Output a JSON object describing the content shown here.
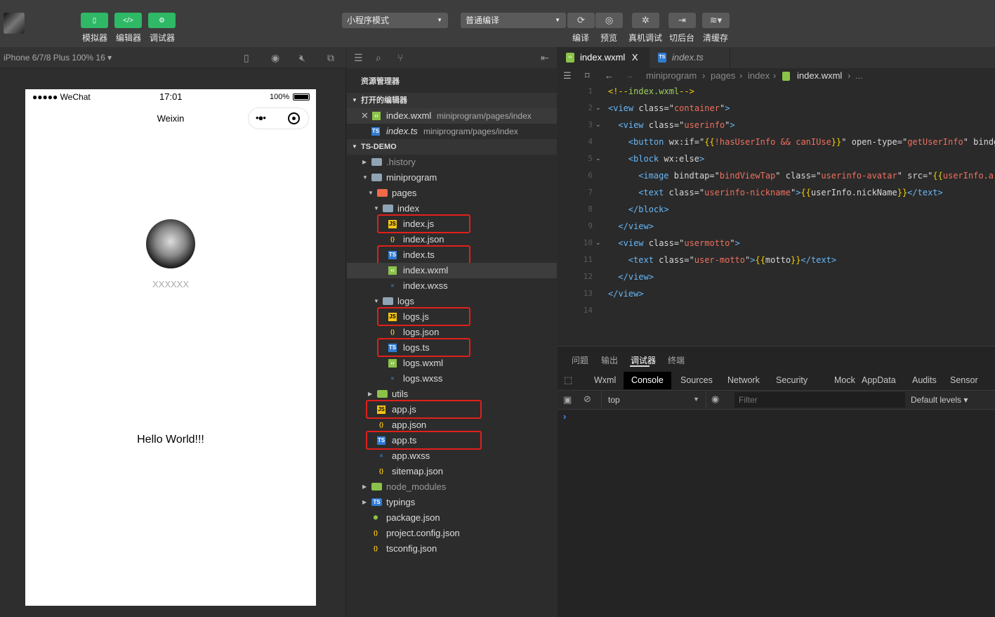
{
  "toolbar": {
    "view_buttons": [
      {
        "label": "模拟器",
        "icon": "phone-icon"
      },
      {
        "label": "编辑器",
        "icon": "code-icon"
      },
      {
        "label": "调试器",
        "icon": "debug-icon"
      }
    ],
    "mode_select": "小程序模式",
    "compile_select": "普通编译",
    "actions": [
      {
        "label": "编译",
        "icon": "refresh-icon"
      },
      {
        "label": "预览",
        "icon": "eye-icon"
      },
      {
        "label": "真机调试",
        "icon": "bug-icon"
      },
      {
        "label": "切后台",
        "icon": "switch-icon"
      },
      {
        "label": "清缓存",
        "icon": "layers-icon"
      }
    ]
  },
  "simulator": {
    "device": "iPhone 6/7/8 Plus 100% 16 ▾",
    "status_carrier": "●●●●● WeChat",
    "status_time": "17:01",
    "status_battery": "100%",
    "nav_title": "Weixin",
    "nickname": "XXXXXX",
    "motto": "Hello World!!!"
  },
  "explorer": {
    "title": "资源管理器",
    "open_editors_label": "打开的编辑器",
    "open_editors": [
      {
        "name": "index.wxml",
        "path": "miniprogram/pages/index",
        "type": "wxml"
      },
      {
        "name": "index.ts",
        "path": "miniprogram/pages/index",
        "type": "ts"
      }
    ],
    "project_label": "TS-DEMO",
    "tree": [
      {
        "name": ".history",
        "level": 1,
        "kind": "folder",
        "open": false,
        "dim": true
      },
      {
        "name": "miniprogram",
        "level": 1,
        "kind": "folder",
        "open": true
      },
      {
        "name": "pages",
        "level": 2,
        "kind": "folder-pages",
        "open": true
      },
      {
        "name": "index",
        "level": 3,
        "kind": "folder",
        "open": true
      },
      {
        "name": "index.js",
        "level": 4,
        "kind": "js",
        "highlight": true
      },
      {
        "name": "index.json",
        "level": 4,
        "kind": "json"
      },
      {
        "name": "index.ts",
        "level": 4,
        "kind": "ts",
        "highlight": true
      },
      {
        "name": "index.wxml",
        "level": 4,
        "kind": "wxml",
        "selected": true
      },
      {
        "name": "index.wxss",
        "level": 4,
        "kind": "wxss"
      },
      {
        "name": "logs",
        "level": 3,
        "kind": "folder",
        "open": true
      },
      {
        "name": "logs.js",
        "level": 4,
        "kind": "js",
        "highlight": true
      },
      {
        "name": "logs.json",
        "level": 4,
        "kind": "json"
      },
      {
        "name": "logs.ts",
        "level": 4,
        "kind": "ts",
        "highlight": true
      },
      {
        "name": "logs.wxml",
        "level": 4,
        "kind": "wxml"
      },
      {
        "name": "logs.wxss",
        "level": 4,
        "kind": "wxss"
      },
      {
        "name": "utils",
        "level": 2,
        "kind": "folder-green",
        "open": false
      },
      {
        "name": "app.js",
        "level": 2,
        "kind": "js",
        "highlight": true,
        "file": true
      },
      {
        "name": "app.json",
        "level": 2,
        "kind": "json",
        "file": true
      },
      {
        "name": "app.ts",
        "level": 2,
        "kind": "ts",
        "highlight": true,
        "file": true
      },
      {
        "name": "app.wxss",
        "level": 2,
        "kind": "wxss",
        "file": true
      },
      {
        "name": "sitemap.json",
        "level": 2,
        "kind": "json",
        "file": true
      },
      {
        "name": "node_modules",
        "level": 1,
        "kind": "folder-green",
        "open": false,
        "dim": true
      },
      {
        "name": "typings",
        "level": 1,
        "kind": "folder-blue",
        "open": false
      },
      {
        "name": "package.json",
        "level": 1,
        "kind": "pkg",
        "file": true
      },
      {
        "name": "project.config.json",
        "level": 1,
        "kind": "json",
        "file": true
      },
      {
        "name": "tsconfig.json",
        "level": 1,
        "kind": "json",
        "file": true
      }
    ]
  },
  "editor": {
    "tabs": [
      {
        "name": "index.wxml",
        "type": "wxml",
        "close": "X",
        "active": true
      },
      {
        "name": "index.ts",
        "type": "ts",
        "active": false
      }
    ],
    "breadcrumb": [
      "miniprogram",
      "pages",
      "index",
      "index.wxml",
      "..."
    ],
    "lines": [
      {
        "fold": false,
        "indent": 0,
        "tokens": [
          [
            "cm",
            "<!--"
          ],
          [
            "c",
            "index.wxml"
          ],
          [
            "cm",
            "-->"
          ]
        ]
      },
      {
        "fold": true,
        "indent": 0,
        "tokens": [
          [
            "t",
            "<view "
          ],
          [
            "a",
            "class="
          ],
          [
            "p",
            "\""
          ],
          [
            "s",
            "container"
          ],
          [
            "p",
            "\""
          ],
          [
            "t",
            ">"
          ]
        ]
      },
      {
        "fold": true,
        "indent": 1,
        "tokens": [
          [
            "t",
            "<view "
          ],
          [
            "a",
            "class="
          ],
          [
            "p",
            "\""
          ],
          [
            "s",
            "userinfo"
          ],
          [
            "p",
            "\""
          ],
          [
            "t",
            ">"
          ]
        ]
      },
      {
        "fold": false,
        "indent": 2,
        "tokens": [
          [
            "t",
            "<button "
          ],
          [
            "a",
            "wx:if="
          ],
          [
            "p",
            "\""
          ],
          [
            "b",
            "{{"
          ],
          [
            "s",
            "!hasUserInfo && canIUse"
          ],
          [
            "b",
            "}}"
          ],
          [
            "p",
            "\" "
          ],
          [
            "a",
            "open-type="
          ],
          [
            "p",
            "\""
          ],
          [
            "s",
            "getUserInfo"
          ],
          [
            "p",
            "\" "
          ],
          [
            "a",
            "bindg"
          ]
        ]
      },
      {
        "fold": true,
        "indent": 2,
        "tokens": [
          [
            "t",
            "<block "
          ],
          [
            "a",
            "wx:else"
          ],
          [
            "t",
            ">"
          ]
        ]
      },
      {
        "fold": false,
        "indent": 3,
        "tokens": [
          [
            "t",
            "<image "
          ],
          [
            "a",
            "bindtap="
          ],
          [
            "p",
            "\""
          ],
          [
            "s",
            "bindViewTap"
          ],
          [
            "p",
            "\" "
          ],
          [
            "a",
            "class="
          ],
          [
            "p",
            "\""
          ],
          [
            "s",
            "userinfo-avatar"
          ],
          [
            "p",
            "\" "
          ],
          [
            "a",
            "src="
          ],
          [
            "p",
            "\""
          ],
          [
            "b",
            "{{"
          ],
          [
            "s",
            "userInfo.a"
          ]
        ]
      },
      {
        "fold": false,
        "indent": 3,
        "tokens": [
          [
            "t",
            "<text "
          ],
          [
            "a",
            "class="
          ],
          [
            "p",
            "\""
          ],
          [
            "s",
            "userinfo-nickname"
          ],
          [
            "p",
            "\""
          ],
          [
            "t",
            ">"
          ],
          [
            "b",
            "{{"
          ],
          [
            "a",
            "userInfo.nickName"
          ],
          [
            "b",
            "}}"
          ],
          [
            "t",
            "</text>"
          ]
        ]
      },
      {
        "fold": false,
        "indent": 2,
        "tokens": [
          [
            "t",
            "</block>"
          ]
        ]
      },
      {
        "fold": false,
        "indent": 1,
        "tokens": [
          [
            "t",
            "</view>"
          ]
        ]
      },
      {
        "fold": true,
        "indent": 1,
        "tokens": [
          [
            "t",
            "<view "
          ],
          [
            "a",
            "class="
          ],
          [
            "p",
            "\""
          ],
          [
            "s",
            "usermotto"
          ],
          [
            "p",
            "\""
          ],
          [
            "t",
            ">"
          ]
        ]
      },
      {
        "fold": false,
        "indent": 2,
        "tokens": [
          [
            "t",
            "<text "
          ],
          [
            "a",
            "class="
          ],
          [
            "p",
            "\""
          ],
          [
            "s",
            "user-motto"
          ],
          [
            "p",
            "\""
          ],
          [
            "t",
            ">"
          ],
          [
            "b",
            "{{"
          ],
          [
            "a",
            "motto"
          ],
          [
            "b",
            "}}"
          ],
          [
            "t",
            "</text>"
          ]
        ]
      },
      {
        "fold": false,
        "indent": 1,
        "tokens": [
          [
            "t",
            "</view>"
          ]
        ]
      },
      {
        "fold": false,
        "indent": 0,
        "tokens": [
          [
            "t",
            "</view>"
          ]
        ]
      },
      {
        "fold": false,
        "indent": 0,
        "tokens": []
      }
    ]
  },
  "panel": {
    "tabs": [
      "问题",
      "输出",
      "调试器",
      "终端"
    ],
    "active_tab": "调试器",
    "devtools_tabs": [
      "Wxml",
      "Console",
      "Sources",
      "Network",
      "Security",
      "Mock",
      "AppData",
      "Audits",
      "Sensor"
    ],
    "active_devtools_tab": "Console",
    "context": "top",
    "filter_placeholder": "Filter",
    "levels": "Default levels ▾",
    "prompt": "›"
  },
  "colors": {
    "accent_green": "#2fb865",
    "highlight_red": "#e0201b"
  }
}
